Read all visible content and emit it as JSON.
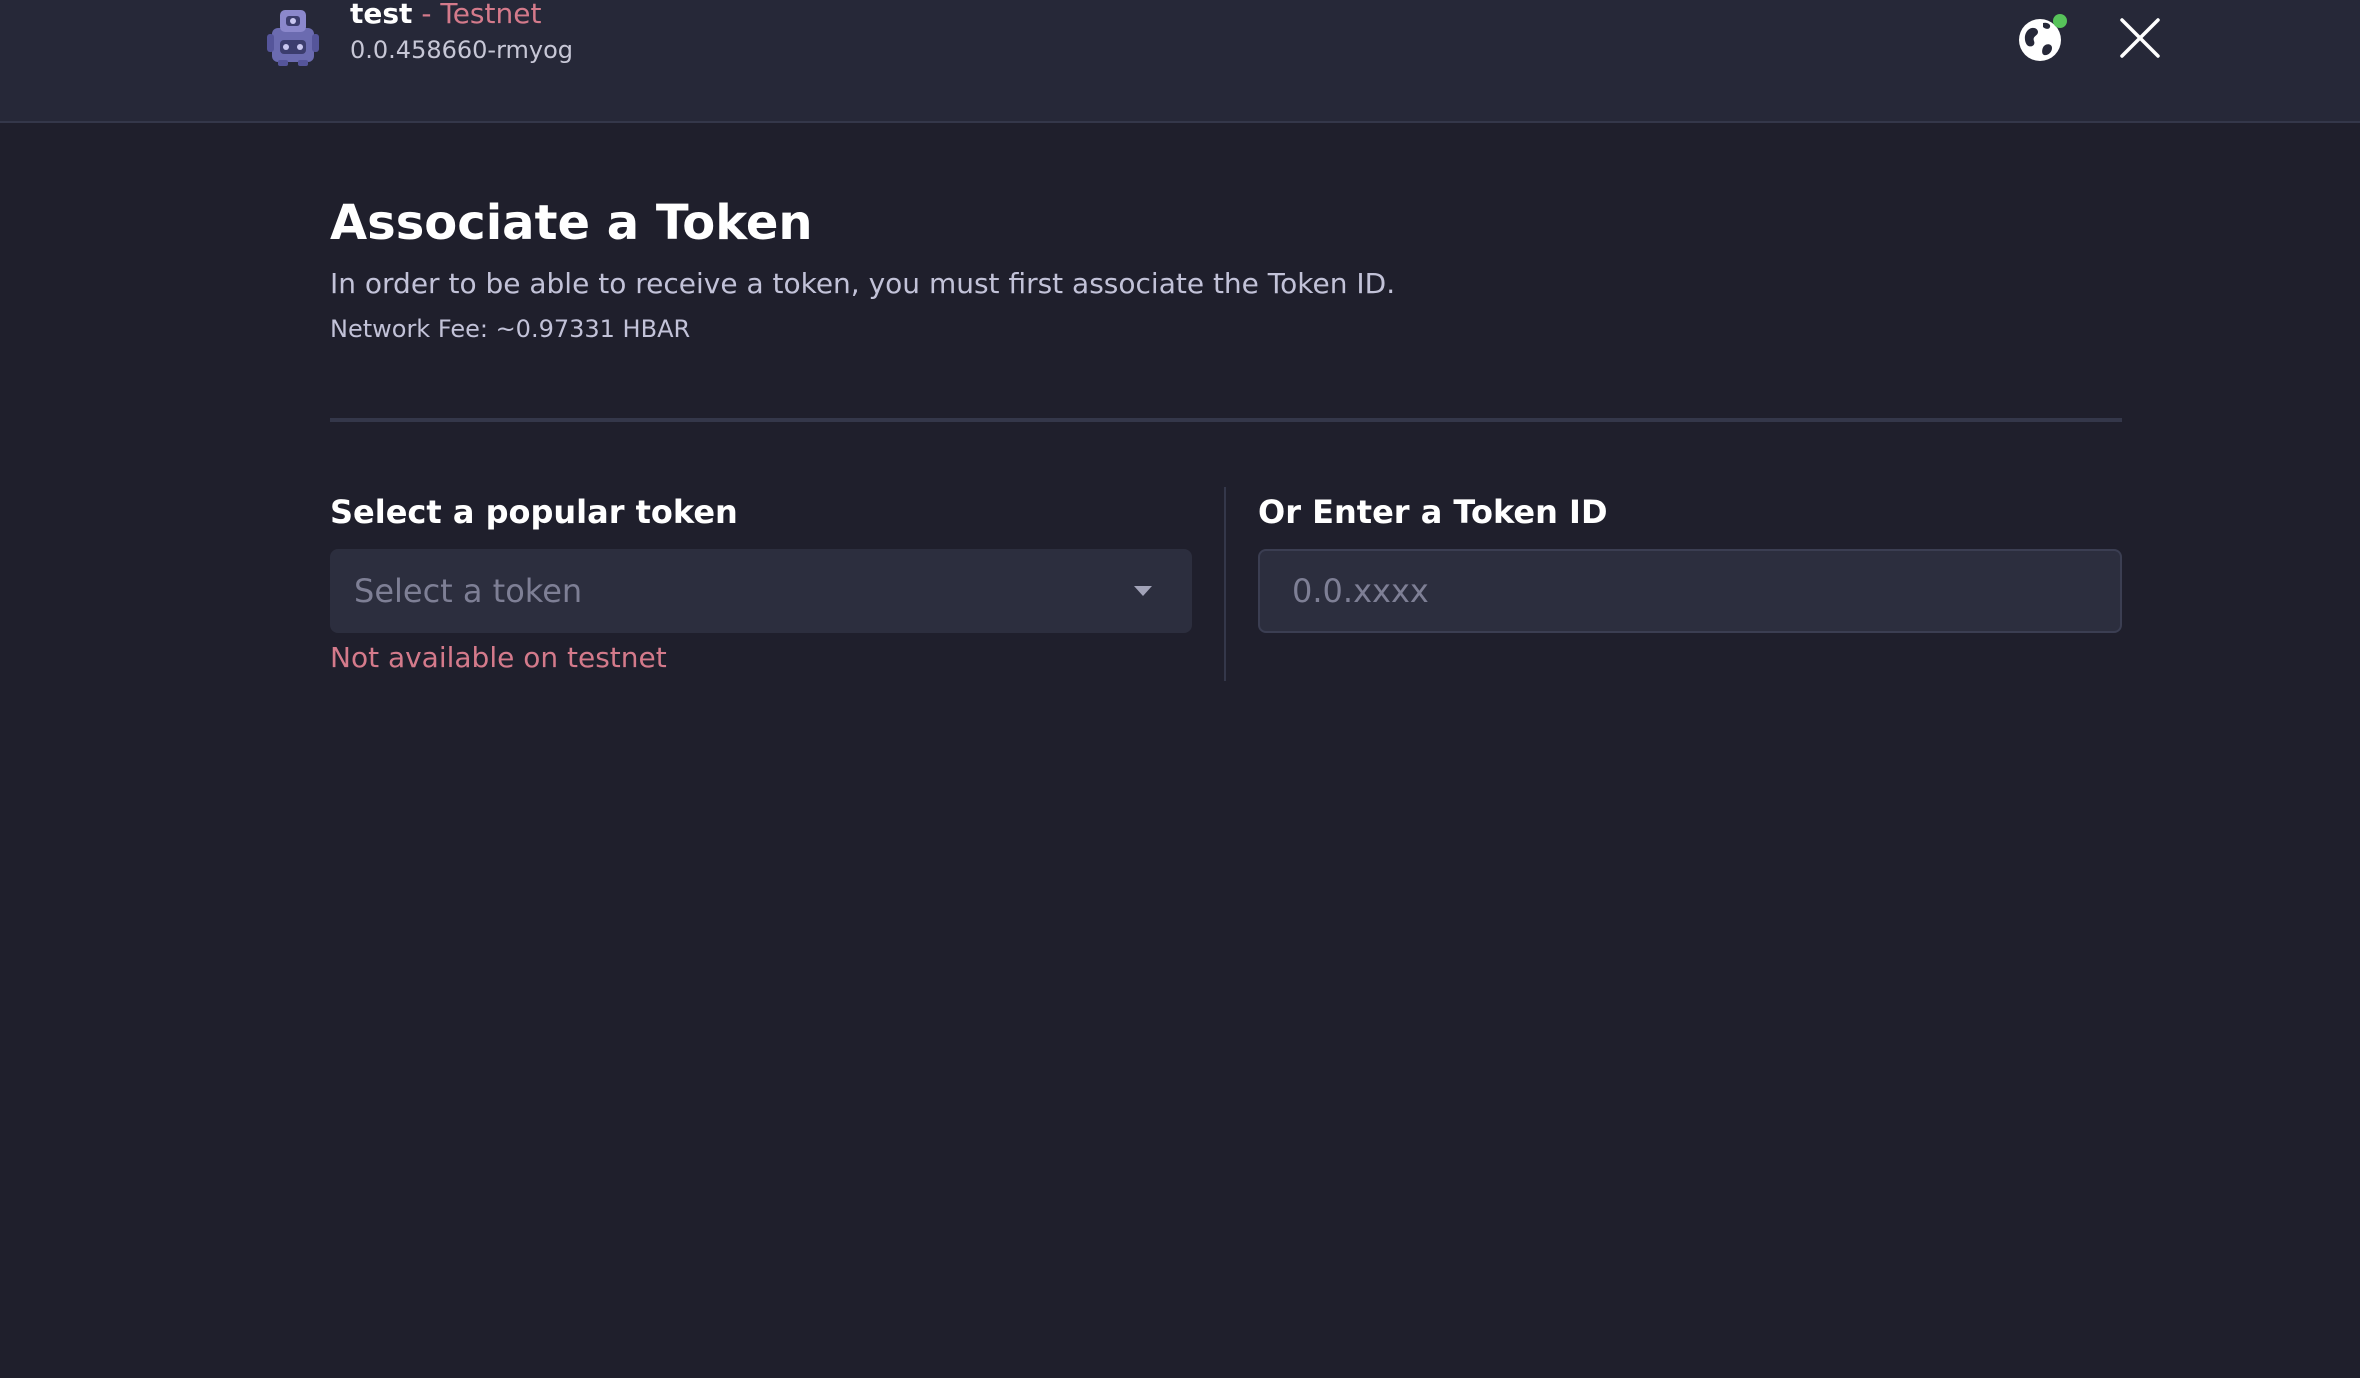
{
  "header": {
    "account_name": "test",
    "separator": " - ",
    "network": "Testnet",
    "account_id": "0.0.458660-rmyog",
    "avatar_icon": "robot-avatar-icon",
    "network_icon": "globe-icon",
    "network_status_color": "#57c35a",
    "close_icon": "close-icon"
  },
  "main": {
    "title": "Associate a Token",
    "subtitle": "In order to be able to receive a token, you must first associate the Token ID.",
    "fee": "Network Fee: ~0.97331 HBAR",
    "popular": {
      "label": "Select a popular token",
      "placeholder": "Select a token",
      "error": "Not available on testnet"
    },
    "manual": {
      "label": "Or Enter a Token ID",
      "placeholder": "0.0.xxxx",
      "value": ""
    }
  },
  "colors": {
    "background": "#1f1f2c",
    "header": "#262838",
    "accent_pink": "#d47a8b",
    "input_bg": "#2c2e3e"
  }
}
